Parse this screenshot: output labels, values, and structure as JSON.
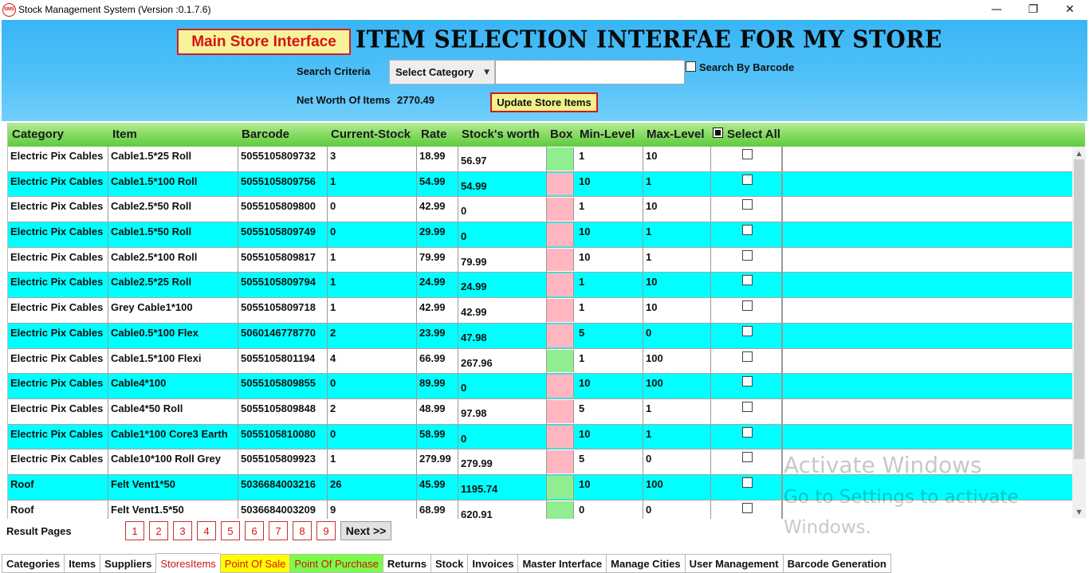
{
  "window": {
    "title": "Stock Management System (Version :0.1.7.6)",
    "icon_text": "SMS"
  },
  "header": {
    "main_store_button": "Main Store Interface",
    "heading": "ITEM SELECTION INTERFAE FOR MY STORE",
    "search_label": "Search Criteria",
    "category_select": "Select Category",
    "search_value": "",
    "search_by_barcode_label": "Search By Barcode",
    "net_worth_label": "Net Worth Of Items",
    "net_worth_value": "2770.49",
    "update_button": "Update Store Items"
  },
  "grid": {
    "columns": [
      "Category",
      "Item",
      "Barcode",
      "Current-Stock",
      "Rate",
      "Stock's worth",
      "Box",
      "Min-Level",
      "Max-Level",
      "Select All"
    ],
    "rows": [
      {
        "category": "Electric Pix Cables",
        "item": "Cable1.5*25 Roll",
        "barcode": "5055105809732",
        "stock": "3",
        "rate": "18.99",
        "worth": "56.97",
        "box": "green",
        "min": "1",
        "max": "10"
      },
      {
        "category": "Electric Pix Cables",
        "item": "Cable1.5*100 Roll",
        "barcode": "5055105809756",
        "stock": "1",
        "rate": "54.99",
        "worth": "54.99",
        "box": "pink",
        "min": "10",
        "max": "1"
      },
      {
        "category": "Electric Pix Cables",
        "item": "Cable2.5*50 Roll",
        "barcode": "5055105809800",
        "stock": "0",
        "rate": "42.99",
        "worth": "0",
        "box": "pink",
        "min": "1",
        "max": "10"
      },
      {
        "category": "Electric Pix Cables",
        "item": "Cable1.5*50 Roll",
        "barcode": "5055105809749",
        "stock": "0",
        "rate": "29.99",
        "worth": "0",
        "box": "pink",
        "min": "10",
        "max": "1"
      },
      {
        "category": "Electric Pix Cables",
        "item": "Cable2.5*100 Roll",
        "barcode": "5055105809817",
        "stock": "1",
        "rate": "79.99",
        "worth": "79.99",
        "box": "pink",
        "min": "10",
        "max": "1"
      },
      {
        "category": "Electric Pix Cables",
        "item": "Cable2.5*25 Roll",
        "barcode": "5055105809794",
        "stock": "1",
        "rate": "24.99",
        "worth": "24.99",
        "box": "pink",
        "min": "1",
        "max": "10"
      },
      {
        "category": "Electric Pix Cables",
        "item": "Grey Cable1*100",
        "barcode": "5055105809718",
        "stock": "1",
        "rate": "42.99",
        "worth": "42.99",
        "box": "pink",
        "min": "1",
        "max": "10"
      },
      {
        "category": "Electric Pix Cables",
        "item": "Cable0.5*100 Flex",
        "barcode": "5060146778770",
        "stock": "2",
        "rate": "23.99",
        "worth": "47.98",
        "box": "pink",
        "min": "5",
        "max": "0"
      },
      {
        "category": "Electric Pix Cables",
        "item": "Cable1.5*100 Flexi",
        "barcode": "5055105801194",
        "stock": "4",
        "rate": "66.99",
        "worth": "267.96",
        "box": "green",
        "min": "1",
        "max": "100"
      },
      {
        "category": "Electric Pix Cables",
        "item": "Cable4*100",
        "barcode": "5055105809855",
        "stock": "0",
        "rate": "89.99",
        "worth": "0",
        "box": "pink",
        "min": "10",
        "max": "100"
      },
      {
        "category": "Electric Pix Cables",
        "item": "Cable4*50 Roll",
        "barcode": "5055105809848",
        "stock": "2",
        "rate": "48.99",
        "worth": "97.98",
        "box": "pink",
        "min": "5",
        "max": "1"
      },
      {
        "category": "Electric Pix Cables",
        "item": "Cable1*100 Core3 Earth",
        "barcode": "5055105810080",
        "stock": "0",
        "rate": "58.99",
        "worth": "0",
        "box": "pink",
        "min": "10",
        "max": "1"
      },
      {
        "category": "Electric Pix Cables",
        "item": "Cable10*100 Roll Grey",
        "barcode": "5055105809923",
        "stock": "1",
        "rate": "279.99",
        "worth": "279.99",
        "box": "pink",
        "min": "5",
        "max": "0"
      },
      {
        "category": "Roof",
        "item": "Felt Vent1*50",
        "barcode": "5036684003216",
        "stock": "26",
        "rate": "45.99",
        "worth": "1195.74",
        "box": "green",
        "min": "10",
        "max": "100"
      },
      {
        "category": "Roof",
        "item": "Felt Vent1.5*50",
        "barcode": "5036684003209",
        "stock": "9",
        "rate": "68.99",
        "worth": "620.91",
        "box": "green",
        "min": "0",
        "max": "0"
      }
    ]
  },
  "colors": {
    "row_alt": "#00ffff",
    "box_green": "#90ee90",
    "box_pink": "#ffb6c1",
    "header_blue": "#39b5f5",
    "grid_header_green": "#86db63",
    "accent_red": "#d61414"
  },
  "pagination": {
    "label": "Result Pages",
    "pages": [
      "1",
      "2",
      "3",
      "4",
      "5",
      "6",
      "7",
      "8",
      "9"
    ],
    "next": "Next >>"
  },
  "watermark": {
    "line1": "Activate Windows",
    "line2": "Go to Settings to activate",
    "line3": "Windows."
  },
  "tabs": [
    {
      "label": "Categories",
      "style": "normal"
    },
    {
      "label": "Items",
      "style": "normal"
    },
    {
      "label": "Suppliers",
      "style": "normal"
    },
    {
      "label": "StoresItems",
      "style": "active"
    },
    {
      "label": "Point Of Sale",
      "style": "pos"
    },
    {
      "label": "Point Of Purchase",
      "style": "pop"
    },
    {
      "label": "Returns",
      "style": "normal"
    },
    {
      "label": "Stock",
      "style": "normal"
    },
    {
      "label": "Invoices",
      "style": "normal"
    },
    {
      "label": "Master Interface",
      "style": "normal"
    },
    {
      "label": "Manage Cities",
      "style": "normal"
    },
    {
      "label": "User Management",
      "style": "normal"
    },
    {
      "label": "Barcode Generation",
      "style": "normal"
    }
  ]
}
